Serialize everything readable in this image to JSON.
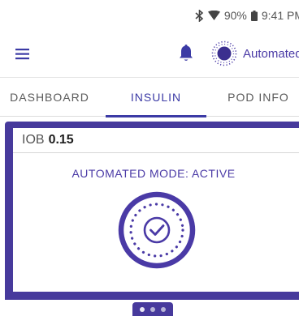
{
  "status_bar": {
    "battery": "90%",
    "time": "9:41 PM",
    "icons": [
      "bluetooth-icon",
      "wifi-icon",
      "battery-icon"
    ]
  },
  "app_bar": {
    "menu_icon": "menu-icon",
    "notification_icon": "bell-icon",
    "mode_icon": "automated-mode-icon",
    "mode_label": "Automated"
  },
  "tabs": [
    {
      "label": "DASHBOARD",
      "active": false
    },
    {
      "label": "INSULIN",
      "active": true
    },
    {
      "label": "POD INFO",
      "active": false
    }
  ],
  "card": {
    "iob_label": "IOB",
    "iob_value": "0.15",
    "mode_status": "AUTOMATED MODE: ACTIVE",
    "status_icon": "automated-mode-active-icon"
  },
  "pager": {
    "count": 3,
    "active_index": 0
  },
  "colors": {
    "brand": "#473a9c",
    "accent_text": "#4a3aa6",
    "tab_active": "#3b3aa5"
  }
}
